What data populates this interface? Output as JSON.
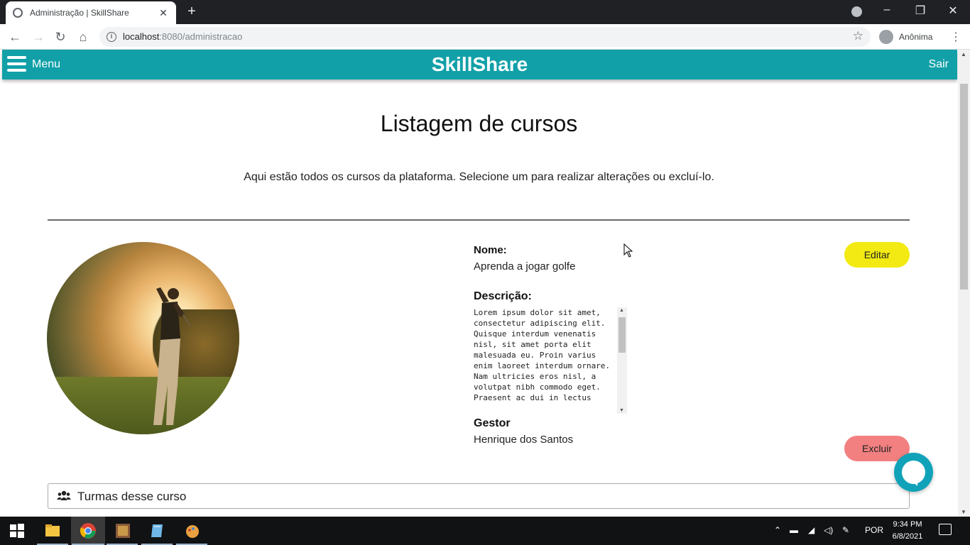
{
  "browser": {
    "tab_title": "Administração | SkillShare",
    "tab_close": "✕",
    "new_tab": "+",
    "url_host": "localhost",
    "url_path": ":8080/administracao",
    "profile_label": "Anônima"
  },
  "header": {
    "menu_label": "Menu",
    "brand": "SkillShare",
    "logout_label": "Sair",
    "color": "#11a0a8"
  },
  "main": {
    "title": "Listagem de cursos",
    "subtitle": "Aqui estão todos os cursos da plataforma. Selecione um para realizar alterações ou excluí-lo."
  },
  "course": {
    "name_label": "Nome:",
    "name": "Aprenda a jogar golfe",
    "description_label": "Descrição:",
    "description": "Lorem ipsum dolor sit amet, consectetur adipiscing elit. Quisque interdum venenatis nisl, sit amet porta elit malesuada eu. Proin varius enim laoreet interdum ornare. Nam ultricies eros nisl, a volutpat nibh commodo eget. Praesent ac dui in lectus",
    "manager_label": "Gestor",
    "manager": "Henrique dos Santos",
    "edit_label": "Editar",
    "delete_label": "Excluir",
    "edit_color": "#f2ea12",
    "delete_color": "#f28080"
  },
  "turmas": {
    "label": "Turmas desse curso",
    "icon": "users-icon"
  },
  "taskbar": {
    "language": "POR",
    "time": "9:34 PM",
    "date": "6/8/2021"
  }
}
